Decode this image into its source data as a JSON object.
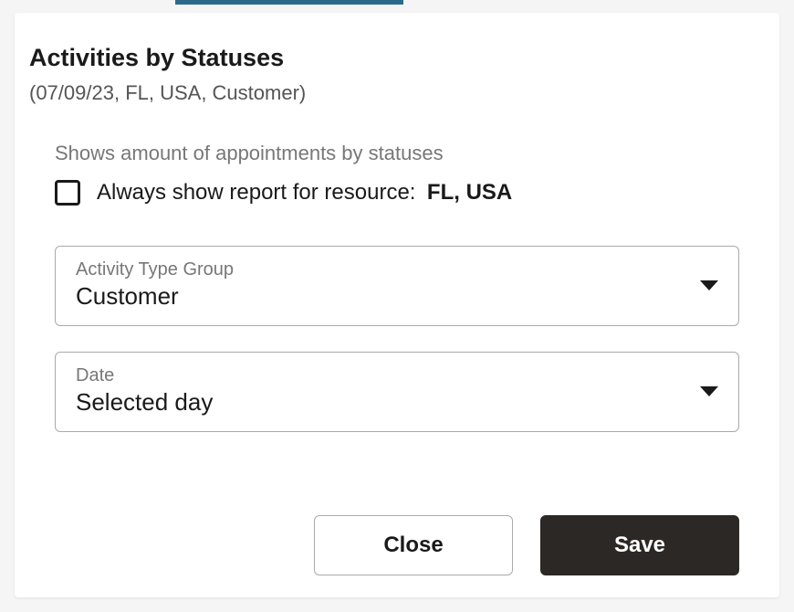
{
  "dialog": {
    "title": "Activities by Statuses",
    "subtitle": "(07/09/23, FL, USA, Customer)"
  },
  "description": "Shows amount of appointments by statuses",
  "checkbox": {
    "label": "Always show report for resource:",
    "value": "FL, USA"
  },
  "fields": {
    "activityTypeGroup": {
      "label": "Activity Type Group",
      "value": "Customer"
    },
    "date": {
      "label": "Date",
      "value": "Selected day"
    }
  },
  "buttons": {
    "close": "Close",
    "save": "Save"
  }
}
